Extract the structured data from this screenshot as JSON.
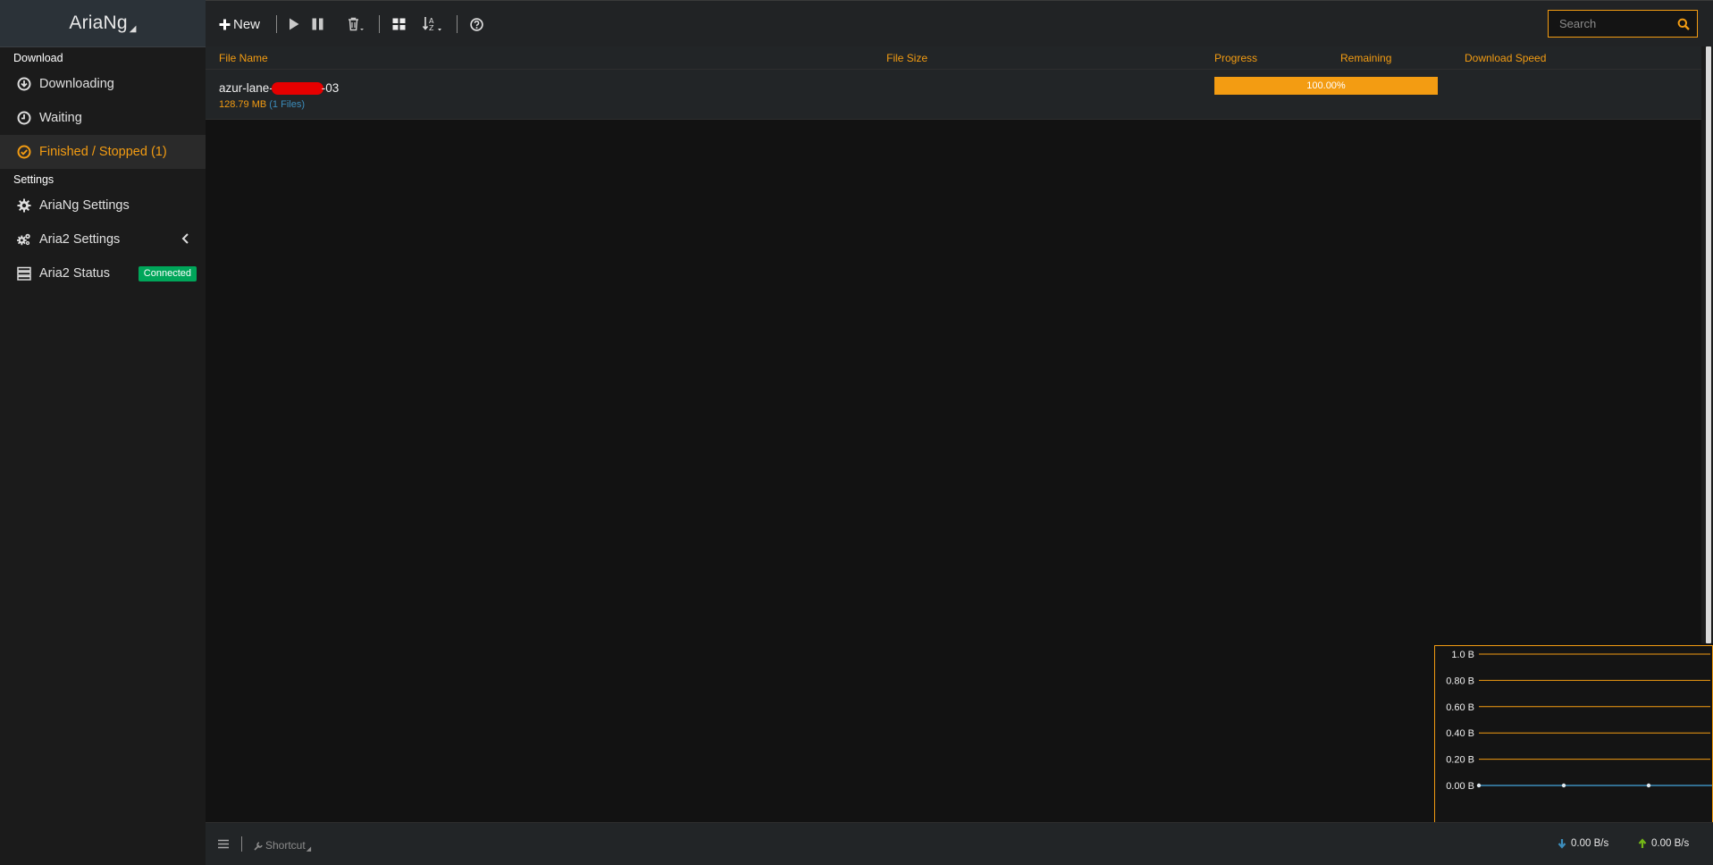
{
  "app": {
    "title": "AriaNg"
  },
  "sidebar": {
    "download_header": "Download",
    "settings_header": "Settings",
    "items": [
      {
        "label": "Downloading",
        "icon": "download-circle-icon"
      },
      {
        "label": "Waiting",
        "icon": "clock-icon"
      },
      {
        "label": "Finished / Stopped (1)",
        "icon": "check-circle-icon",
        "active": true
      },
      {
        "label": "AriaNg Settings",
        "icon": "gear-icon"
      },
      {
        "label": "Aria2 Settings",
        "icon": "gears-icon"
      },
      {
        "label": "Aria2 Status",
        "icon": "server-icon",
        "badge": "Connected"
      }
    ]
  },
  "toolbar": {
    "new_label": "New",
    "search_placeholder": "Search"
  },
  "table": {
    "columns": {
      "file_name": "File Name",
      "file_size": "File Size",
      "progress": "Progress",
      "remaining": "Remaining",
      "download_speed": "Download Speed"
    },
    "rows": [
      {
        "name_prefix": "azur-lane-",
        "name_suffix": "-03",
        "size": "128.79 MB",
        "files": "(1 Files)",
        "progress_label": "100.00%",
        "progress_fraction": 1.0
      }
    ]
  },
  "footer": {
    "shortcut_label": "Shortcut",
    "download_speed": "0.00 B/s",
    "upload_speed": "0.00 B/s"
  },
  "colors": {
    "accent": "#f39c12",
    "connected": "#00a65a",
    "link": "#3c8dbc",
    "download_arrow": "#3c8dbc",
    "upload_arrow": "#74b816"
  },
  "chart_data": {
    "type": "line",
    "y_tick_labels": [
      "1.0 B",
      "0.80 B",
      "0.60 B",
      "0.40 B",
      "0.20 B",
      "0.00 B"
    ],
    "ylim": [
      0,
      1.0
    ],
    "grid": true,
    "series": [
      {
        "values": [
          0,
          0,
          0,
          0
        ]
      }
    ]
  }
}
